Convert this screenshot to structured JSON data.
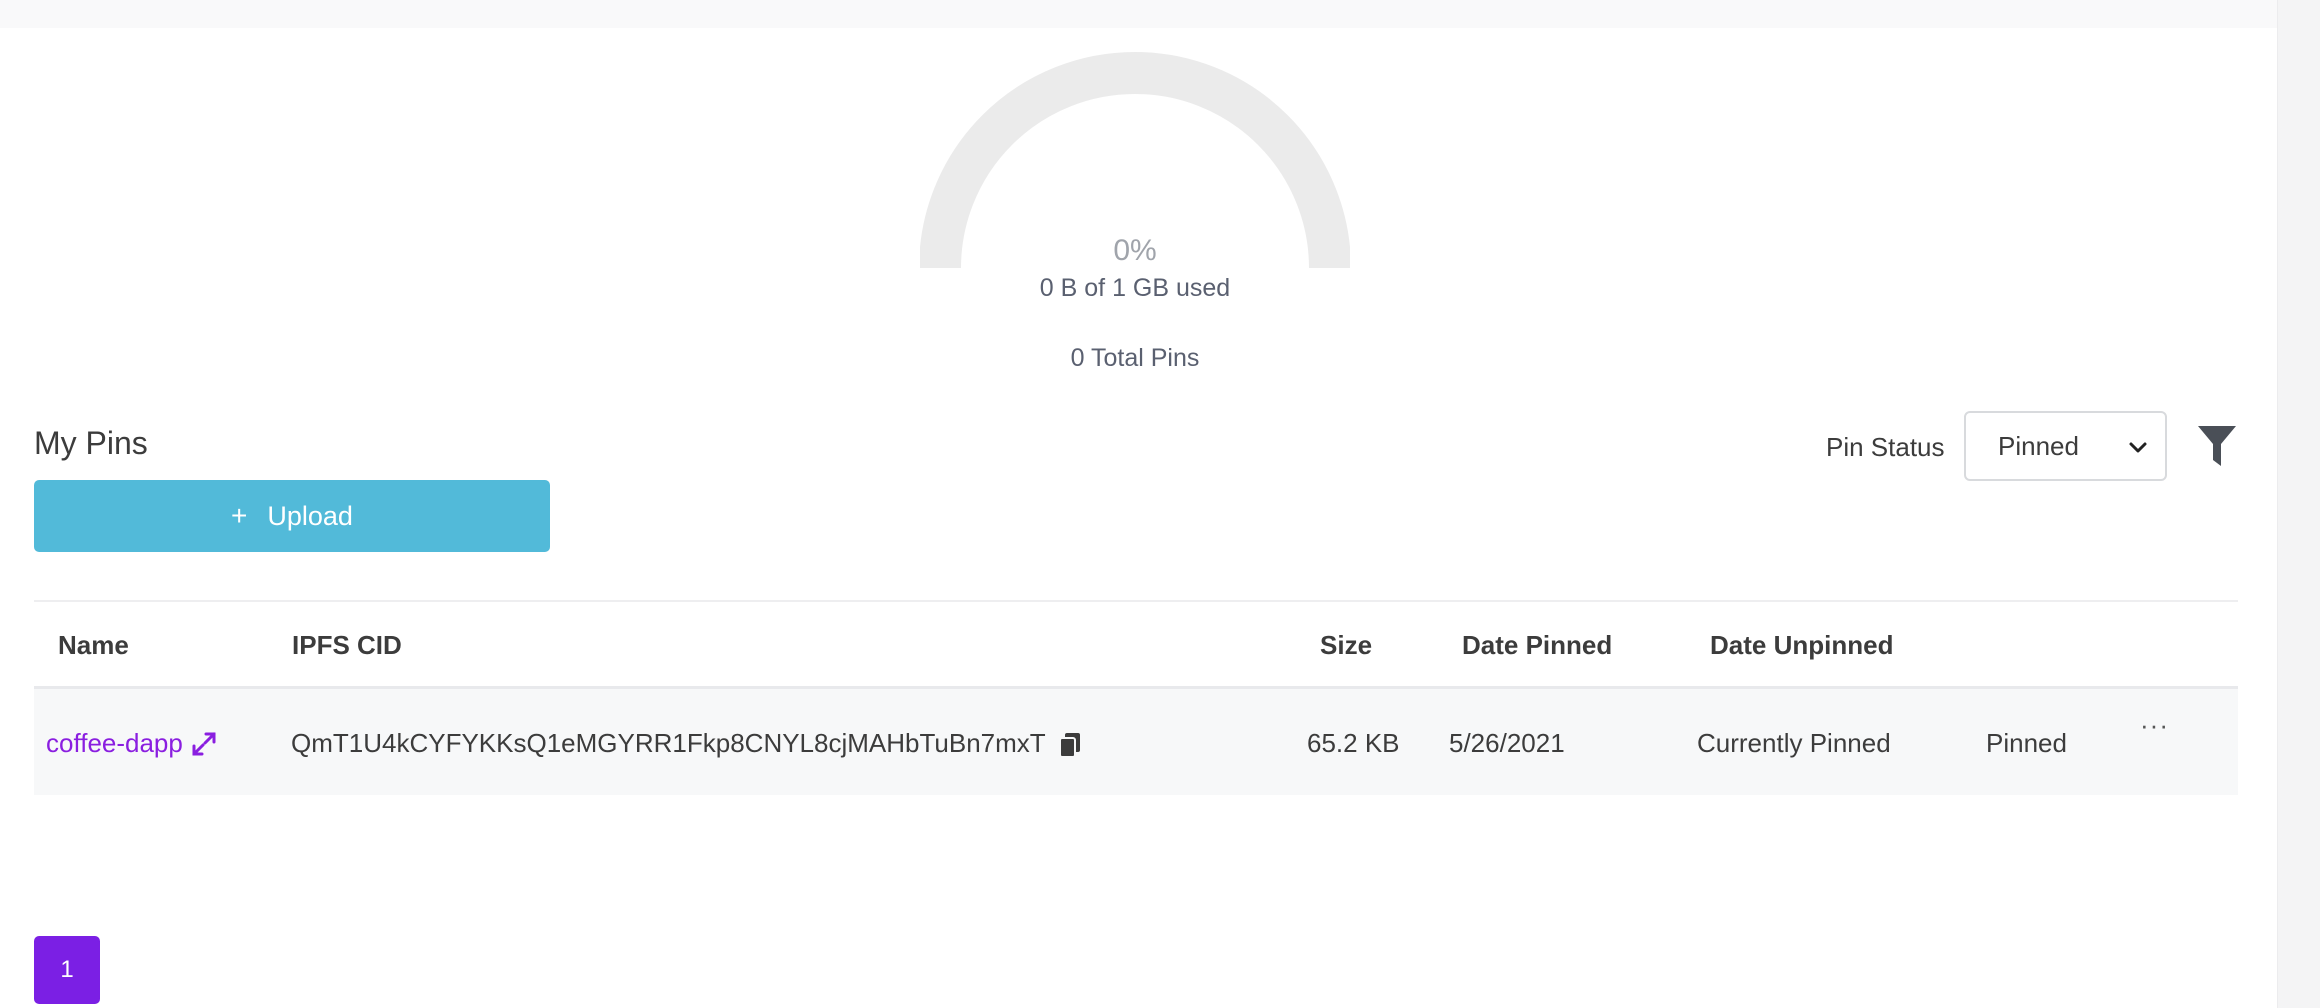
{
  "usage": {
    "percent_text": "0%",
    "used_text": "0 B of 1 GB used",
    "total_pins_text": "0 Total Pins",
    "fraction": 0
  },
  "pins": {
    "title": "My Pins",
    "upload_label": "Upload",
    "upload_icon": "plus-icon",
    "filter": {
      "label": "Pin Status",
      "selected": "Pinned"
    },
    "filter_icon": "funnel-icon",
    "columns": [
      "Name",
      "IPFS CID",
      "Size",
      "Date Pinned",
      "Date Unpinned"
    ],
    "rows": [
      {
        "name": "coffee-dapp",
        "cid": "QmT1U4kCYFYKKsQ1eMGYRR1Fkp8CNYL8cjMAHbTuBn7mxT",
        "size": "65.2 KB",
        "date_pinned": "5/26/2021",
        "date_unpinned": "Currently Pinned",
        "status": "Pinned",
        "more": "···"
      }
    ]
  },
  "pagination": {
    "current_page": "1"
  },
  "colors": {
    "accent_purple": "#7b1fe4",
    "link_purple": "#8a1ee0",
    "upload_blue": "#52bad9",
    "gauge_track": "#ebebeb"
  }
}
